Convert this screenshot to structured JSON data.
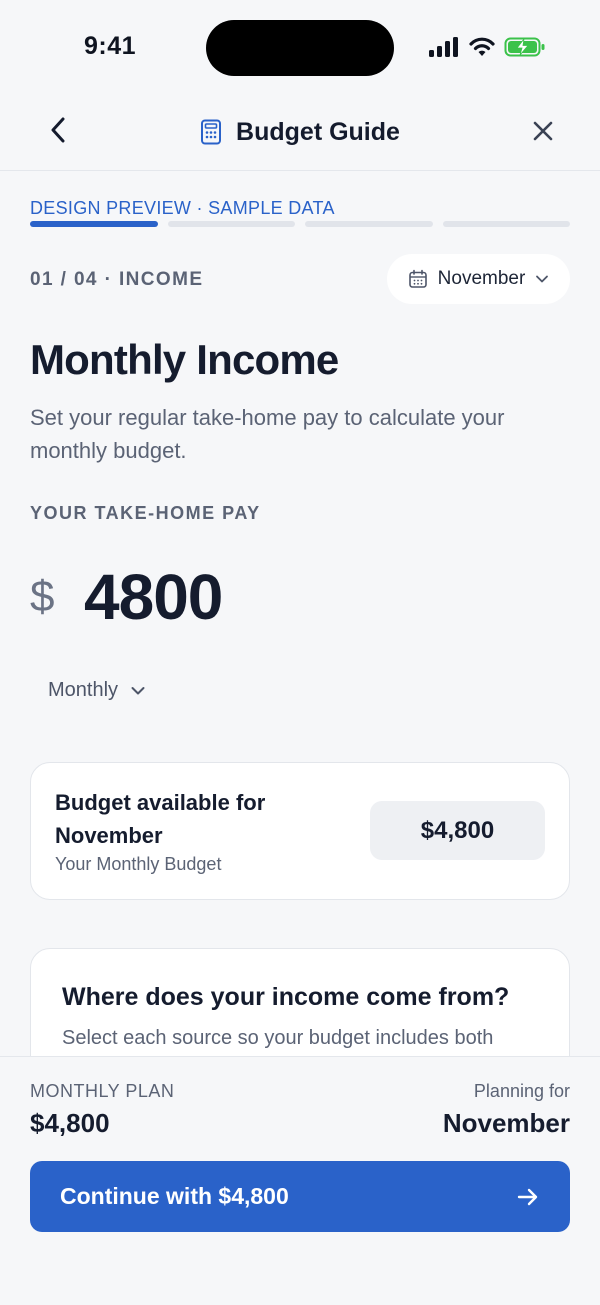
{
  "status_bar": {
    "time": "9:41"
  },
  "nav": {
    "title": "Budget Guide"
  },
  "progress": {
    "banner": "DESIGN PREVIEW · SAMPLE DATA",
    "total_steps": 4,
    "current_step": 1
  },
  "step": {
    "label": "01 / 04 · INCOME",
    "month_selector": "November"
  },
  "content": {
    "title": "Monthly Income",
    "subtitle": "Set your regular take-home pay to calculate your monthly budget.",
    "pay_label": "YOUR TAKE-HOME PAY",
    "currency_symbol": "$",
    "amount": "4800",
    "frequency": "Monthly"
  },
  "budget_card": {
    "title": "Budget available for November",
    "subtitle": "Your Monthly Budget",
    "value": "$4,800"
  },
  "income_sources_card": {
    "title": "Where does your income come from?",
    "subtitle": "Select each source so your budget includes both"
  },
  "footer": {
    "plan_label": "MONTHLY PLAN",
    "plan_value": "$4,800",
    "planning_label": "Planning for",
    "planning_value": "November",
    "cta_label": "Continue with $4,800"
  },
  "colors": {
    "accent": "#2a62c9",
    "background": "#f6f7f9",
    "battery": "#3bc24a"
  }
}
